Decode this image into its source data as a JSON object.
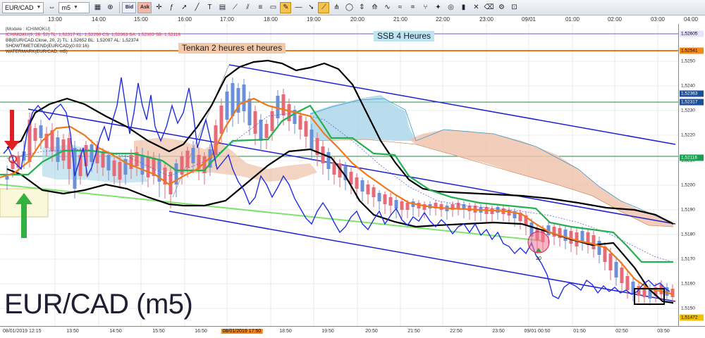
{
  "toolbar": {
    "symbol": "EUR/CAD",
    "timeframe": "m5",
    "bid_label": "Bid",
    "ask_label": "Ask"
  },
  "time_axis_top": [
    "13:00",
    "14:00",
    "15:00",
    "16:00",
    "17:00",
    "18:00",
    "19:00",
    "20:00",
    "21:00",
    "22:00",
    "23:00",
    "09/01",
    "01:00",
    "02:00",
    "03:00",
    "04:00"
  ],
  "time_axis_bottom": [
    "08/01/2019 12:15",
    "13:50",
    "14:50",
    "15:50",
    "16:50",
    "08/01/2019 17:50",
    "18:50",
    "19:50",
    "20:50",
    "21:50",
    "22:50",
    "23:50",
    "09/01 00:50",
    "01:50",
    "02:50",
    "03:50"
  ],
  "info_lines": {
    "model": "[Modele : ICHIMOKU]",
    "ichimoku": "ICHIMOKU(9, 26, 52)  TL: 1,52317  KL: 1,52290  CS: 1,52363  SA: 1,52303  SB: 1,52116",
    "bb": "BB(EUR/CAD.Close, 20, 2)  TL: 1,52652  BL: 1,52097  AL: 1,52374",
    "showtime": "SHOWTIMETOEND(EUR/CAD)(0:03:16)",
    "watermark": "WATERMARK(EUR/CAD, m5)"
  },
  "labels": {
    "ssb": "SSB 4 Heures",
    "tenkan": "Tenkan 2 heures et heures",
    "watermark": "EUR/CAD (m5)",
    "signal_count": "20"
  },
  "price_axis": {
    "ticks": [
      "1,5250",
      "1,5240",
      "1,5230",
      "1,5220",
      "1,5210",
      "1,5200",
      "1,5190",
      "1,5180",
      "1,5170",
      "1,5160",
      "1,5150"
    ],
    "tags": [
      {
        "text": "1,52605",
        "bg": "#e8e0ff",
        "fg": "#000000"
      },
      {
        "text": "1,52541",
        "bg": "#f28a1c",
        "fg": "#000000"
      },
      {
        "text": "1,52363",
        "bg": "#1c4f9c",
        "fg": "#ffffff"
      },
      {
        "text": "1,52317",
        "bg": "#1c4f9c",
        "fg": "#ffffff"
      },
      {
        "text": "1,52116",
        "bg": "#18a050",
        "fg": "#ffffff"
      },
      {
        "text": "1,51472",
        "bg": "#f2c200",
        "fg": "#000000"
      }
    ]
  },
  "colors": {
    "channel": "#1f1fd0",
    "bollinger": "#000000",
    "kijun": "#22b050",
    "tenkan": "#f07818",
    "chikou": "#1f2fe0",
    "kumo_bull": "#a9d4e8",
    "kumo_bear": "#efc4ae",
    "candle_up": "#6b8fd8",
    "candle_down": "#e66a78",
    "ssb_line": "#b8a8f0",
    "tenkan_line": "#f07818",
    "trend": "#7de36b"
  },
  "icons": [
    "chart-icon",
    "crosshair-icon",
    "zoom-in-icon",
    "zoom-out-icon",
    "grid-icon",
    "bar-icon",
    "candle-icon",
    "line-icon",
    "indicator-icon",
    "template-icon",
    "draw-icon",
    "text-icon",
    "arrow-icon",
    "channel-icon",
    "fibonacci-icon",
    "shape-icon",
    "measure-icon",
    "delete-icon",
    "settings-icon",
    "share-icon"
  ]
}
